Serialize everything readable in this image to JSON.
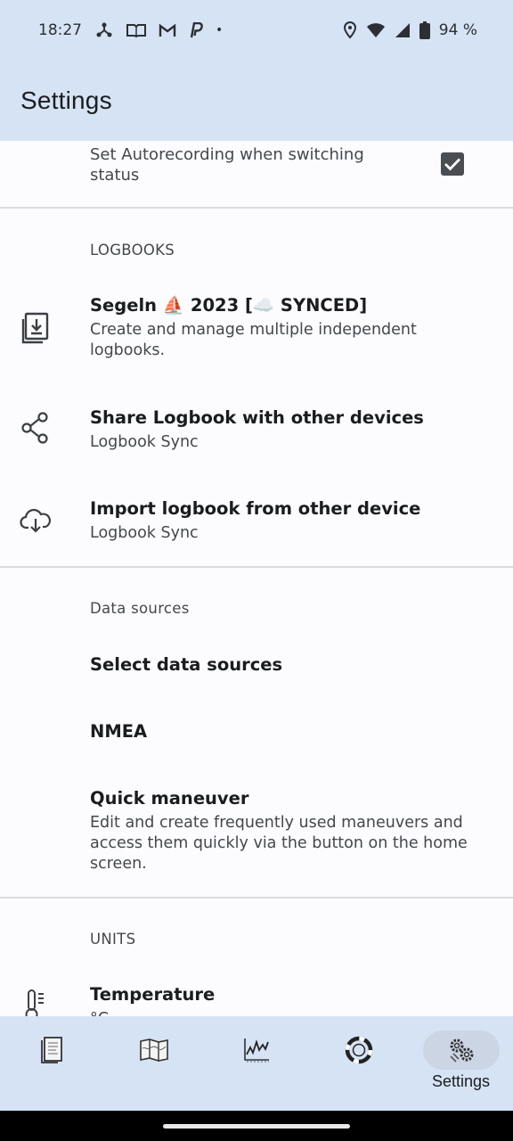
{
  "status_bar": {
    "time": "18:27",
    "battery": "94 %",
    "dot": "•"
  },
  "app_bar": {
    "title": "Settings"
  },
  "settings": {
    "autorecording": {
      "title": "Set Autorecording when switching status",
      "checked": true
    },
    "logbooks_header": "LOGBOOKS",
    "logbook_current": {
      "title": "Segeln ⛵ 2023 [☁️ SYNCED]",
      "summary": "Create and manage multiple independent logbooks."
    },
    "share_logbook": {
      "title": "Share Logbook with other devices",
      "summary": "Logbook Sync"
    },
    "import_logbook": {
      "title": "Import logbook from other device",
      "summary": "Logbook Sync"
    },
    "data_sources_header": "Data sources",
    "select_data_sources": {
      "title": "Select data sources"
    },
    "nmea": {
      "title": "NMEA"
    },
    "quick_maneuver": {
      "title": "Quick maneuver",
      "summary": "Edit and create frequently used maneuvers and access them quickly via the button on the home screen."
    },
    "units_header": "UNITS",
    "temperature": {
      "title": "Temperature",
      "summary": "°C"
    }
  },
  "bottom_nav": {
    "items": [
      {
        "icon": "logbook-icon"
      },
      {
        "icon": "map-icon"
      },
      {
        "icon": "chart-icon"
      },
      {
        "icon": "lifebuoy-icon"
      },
      {
        "icon": "settings-gears-icon",
        "label": "Settings",
        "active": true
      }
    ]
  },
  "colors": {
    "bar_bg": "#d6e3f5",
    "active_pill": "#cbd5e4",
    "page_bg": "#fcfcff"
  }
}
